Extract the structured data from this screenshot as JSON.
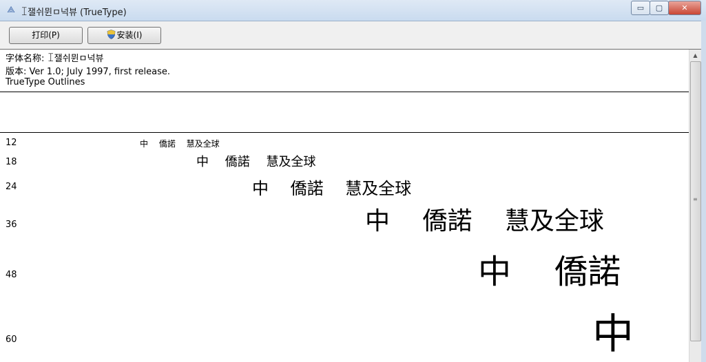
{
  "window": {
    "title": "ꀤ잴쉬뮌ㅁ넉뷰 (TrueType)",
    "app_icon": "font-viewer-icon",
    "controls": {
      "minimize": "▭",
      "maximize": "▢",
      "close": "✕"
    }
  },
  "toolbar": {
    "print_label": "打印(P)",
    "install_label": "安装(I)",
    "install_icon": "uac-shield-icon"
  },
  "font_info": {
    "name_line": "字体名称: ꀤ잴쉬뮌ㅁ넉뷰",
    "version_line": "版本: Ver 1.0; July 1997, first release.",
    "outline_line": "TrueType Outlines"
  },
  "samples": [
    {
      "size": "12",
      "text": "中　 僑諾　 慧及全球"
    },
    {
      "size": "18",
      "text": "中　 僑諾　 慧及全球"
    },
    {
      "size": "24",
      "text": "中　 僑諾　 慧及全球"
    },
    {
      "size": "36",
      "text": "中　 僑諾　 慧及全球"
    },
    {
      "size": "48",
      "text": "中　 僑諾"
    },
    {
      "size": "60",
      "text": "中"
    }
  ],
  "scrollbar": {
    "up_arrow": "▲",
    "grip": "≡"
  }
}
